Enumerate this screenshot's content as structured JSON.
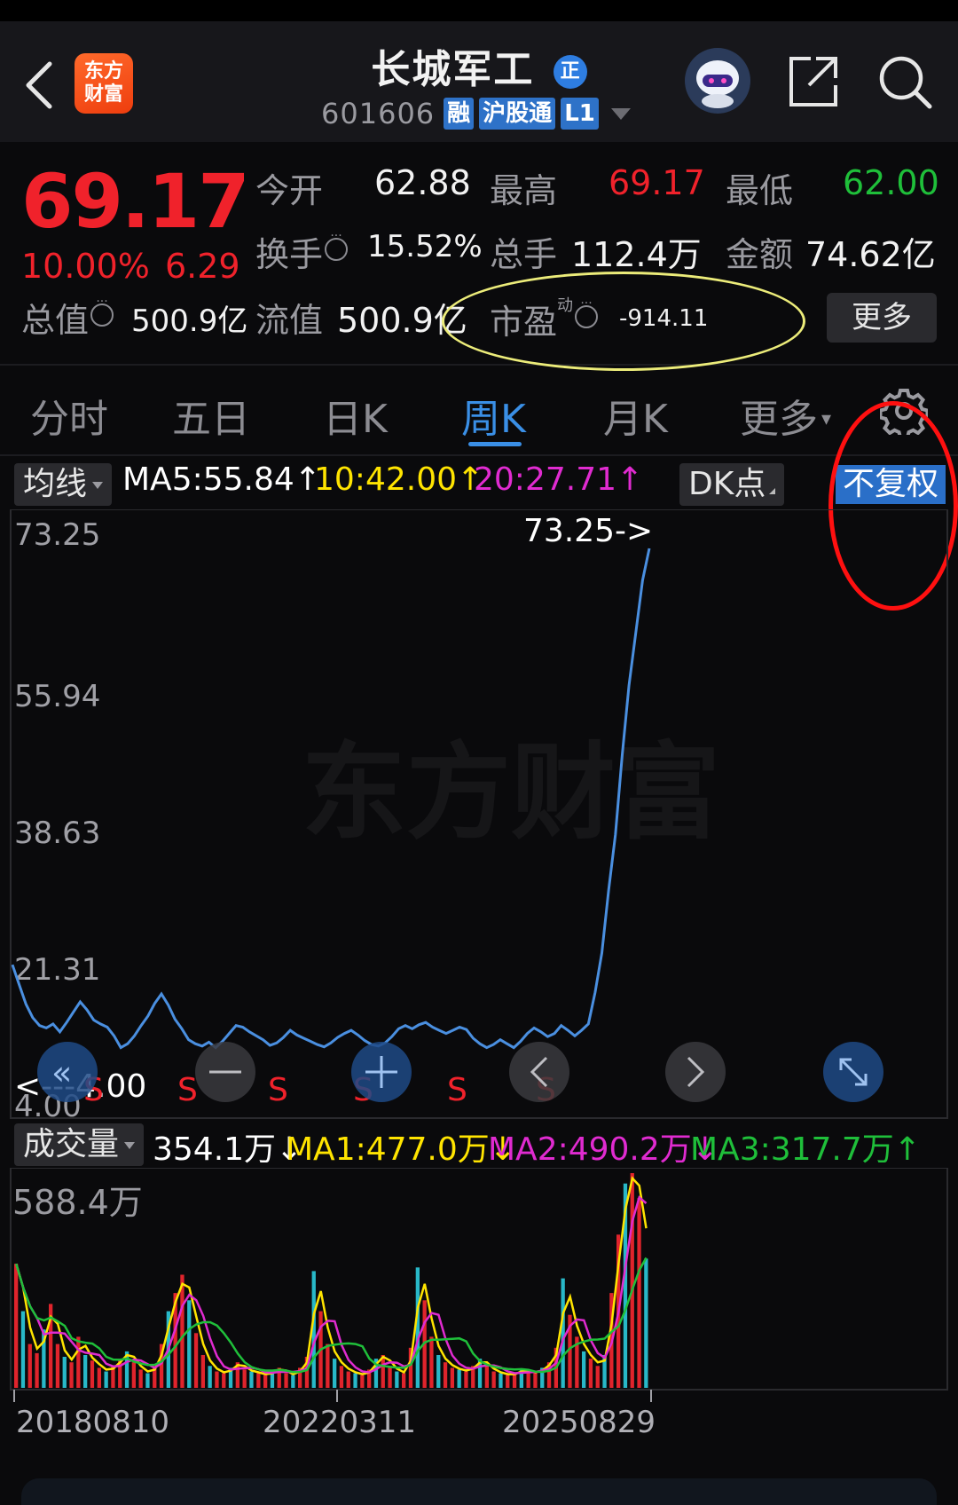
{
  "header": {
    "logo_line1": "东方",
    "logo_line2": "财富",
    "name": "长城军工",
    "name_badge": "正",
    "code": "601606",
    "tags": [
      "融",
      "沪股通",
      "L1"
    ]
  },
  "quote": {
    "price": "69.17",
    "change_pct": "10.00%",
    "change": "6.29",
    "open_label": "今开",
    "open": "62.88",
    "high_label": "最高",
    "high": "69.17",
    "low_label": "最低",
    "low": "62.00",
    "turnover_label": "换手",
    "turnover": "15.52%",
    "volume_label": "总手",
    "volume": "112.4万",
    "amount_label": "金额",
    "amount": "74.62亿",
    "mktcap_label": "总值",
    "mktcap": "500.9亿",
    "float_label": "流值",
    "float": "500.9亿",
    "pe_label": "市盈",
    "pe_sup": "动",
    "pe": "-914.11",
    "more_label": "更多",
    "colors": {
      "up": "#f0222b",
      "down": "#1fbf3a"
    }
  },
  "tabs": {
    "items": [
      "分时",
      "五日",
      "日K",
      "周K",
      "月K",
      "更多"
    ],
    "active": "周K"
  },
  "ma_bar": {
    "selector": "均线",
    "ma5": "MA5:55.84↑",
    "ma10": "10:42.00↑",
    "ma20": "20:27.71↑",
    "dk": "DK点",
    "adjust": "不复权",
    "colors": {
      "ma5": "#ffffff",
      "ma10": "#ffe400",
      "ma20": "#e02bd0"
    }
  },
  "chart_data": {
    "type": "line",
    "price_axis": {
      "ticks": [
        "73.25",
        "55.94",
        "38.63",
        "21.31",
        "4.00"
      ],
      "range": [
        4.0,
        73.25
      ]
    },
    "max_label": "73.25->",
    "min_label": "<---4.00",
    "sell_marks": [
      "S",
      "S",
      "S",
      "S",
      "S",
      "S"
    ],
    "price_series": [
      20.5,
      18.0,
      15.5,
      13.8,
      12.8,
      12.5,
      13.0,
      12.0,
      13.2,
      14.5,
      15.8,
      14.8,
      13.5,
      13.0,
      12.6,
      11.5,
      10.0,
      10.5,
      11.5,
      12.8,
      14.0,
      15.6,
      16.8,
      15.4,
      13.6,
      12.4,
      11.0,
      10.5,
      10.2,
      10.7,
      10.0,
      10.8,
      11.8,
      12.8,
      12.6,
      12.0,
      11.5,
      11.0,
      10.3,
      10.6,
      11.3,
      12.2,
      11.6,
      11.2,
      10.8,
      10.4,
      10.1,
      10.6,
      11.3,
      11.8,
      12.2,
      11.6,
      10.9,
      10.4,
      10.2,
      10.6,
      11.4,
      12.4,
      12.8,
      12.4,
      12.9,
      13.2,
      12.6,
      12.2,
      11.8,
      12.2,
      12.6,
      12.3,
      11.2,
      10.5,
      10.0,
      10.4,
      11.0,
      10.5,
      10.0,
      10.8,
      11.8,
      12.5,
      12.0,
      11.4,
      11.8,
      12.8,
      12.2,
      11.5,
      12.2,
      13.0,
      17.0,
      22.0,
      30.0,
      37.0,
      47.0,
      55.9,
      62.5,
      69.2,
      73.25
    ],
    "volume_axis": {
      "max_label": "588.4万",
      "max": 588.4
    },
    "volume_summary": {
      "selector": "成交量",
      "current": "354.1万↓",
      "ma1": "MA1:477.0万↓",
      "ma2": "MA2:490.2万↓",
      "ma3": "MA3:317.7万↑",
      "colors": {
        "ma1": "#ffe400",
        "ma2": "#e02bd0",
        "ma3": "#1fbf3a"
      }
    },
    "volume_series": [
      340,
      210,
      120,
      95,
      160,
      230,
      120,
      85,
      70,
      140,
      90,
      75,
      55,
      45,
      60,
      80,
      100,
      70,
      50,
      40,
      60,
      120,
      210,
      260,
      310,
      240,
      150,
      90,
      60,
      45,
      40,
      55,
      70,
      50,
      45,
      40,
      35,
      45,
      55,
      40,
      35,
      55,
      85,
      320,
      210,
      120,
      80,
      60,
      45,
      40,
      35,
      50,
      80,
      90,
      60,
      45,
      40,
      110,
      330,
      240,
      140,
      90,
      70,
      55,
      50,
      45,
      60,
      80,
      60,
      45,
      40,
      35,
      40,
      50,
      45,
      40,
      55,
      70,
      110,
      300,
      200,
      140,
      100,
      80,
      60,
      90,
      260,
      420,
      560,
      588.4,
      520,
      354.1
    ],
    "x_labels": [
      "20180810",
      "20220311",
      "20250829"
    ]
  }
}
